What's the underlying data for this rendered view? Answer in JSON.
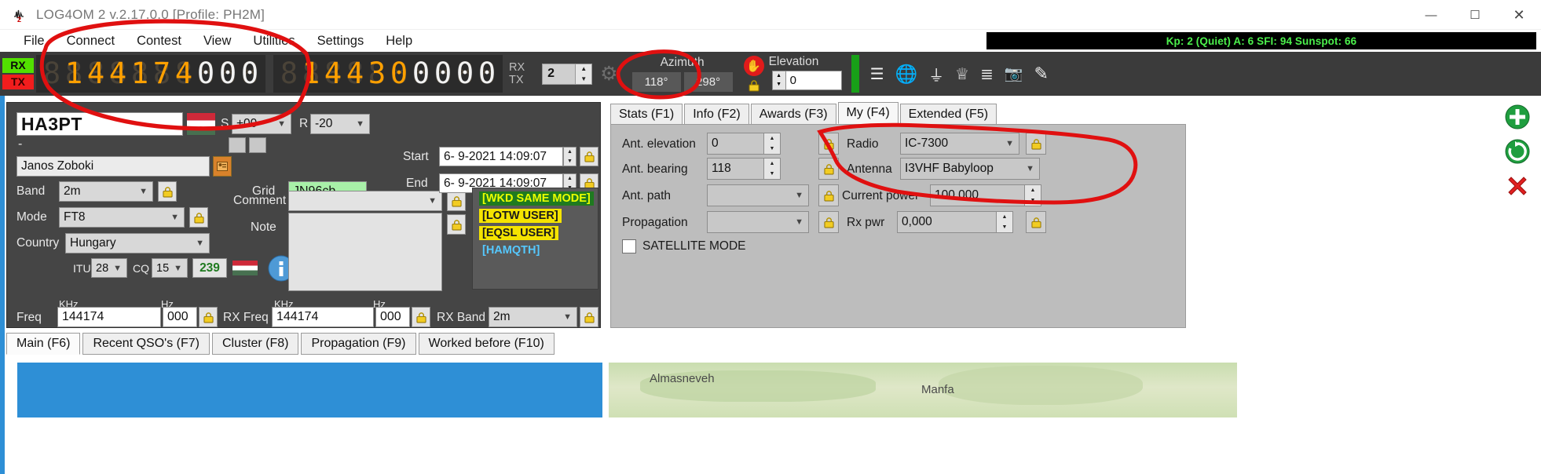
{
  "window": {
    "title": "LOG4OM 2 v.2.17.0.0 [Profile: PH2M]",
    "icon": "log4om-icon",
    "minimize": "—",
    "maximize": "☐",
    "close": "✕"
  },
  "menubar": {
    "items": [
      {
        "label": "File",
        "name": "menu-file"
      },
      {
        "label": "Connect",
        "name": "menu-connect"
      },
      {
        "label": "Contest",
        "name": "menu-contest"
      },
      {
        "label": "View",
        "name": "menu-view"
      },
      {
        "label": "Utilities",
        "name": "menu-utilities"
      },
      {
        "label": "Settings",
        "name": "menu-settings"
      },
      {
        "label": "Help",
        "name": "menu-help"
      }
    ],
    "space_weather": "Kp: 2 (Quiet)  A: 6  SFI: 94 Sunspot: 66"
  },
  "toolbar": {
    "rx_label": "RX",
    "tx_label": "TX",
    "tx_frequency_digits": "0144174000",
    "rx_frequency_digits": "0144300000",
    "tx_rx_caption_1": "RX",
    "tx_rx_caption_2": "TX",
    "radio_selector_value": "2",
    "gear_icon": "gear-icon",
    "azimuth_label": "Azimuth",
    "azimuth_value_1": "118°",
    "azimuth_value_2": "298°",
    "rotor_stop_icon": "hand-stop-icon",
    "elevation_label": "Elevation",
    "elevation_value": "0",
    "elevation_lock_icon": "lock-icon",
    "icons": [
      {
        "name": "signal-icon",
        "glyph": "📶"
      },
      {
        "name": "globe-icon",
        "glyph": "🌐"
      },
      {
        "name": "antenna-icon",
        "glyph": "⮟"
      },
      {
        "name": "award-icon",
        "glyph": "🏅"
      },
      {
        "name": "list-icon",
        "glyph": "☰"
      },
      {
        "name": "camera-icon",
        "glyph": "📷"
      },
      {
        "name": "pencil-icon",
        "glyph": "✎"
      }
    ]
  },
  "qso": {
    "callsign": "HA3PT",
    "flag": "hungary-flag",
    "s_label": "S",
    "s_value": "+00",
    "r_label": "R",
    "r_value": "-20",
    "dash": "-",
    "operator_name": "Janos Zoboki",
    "contact_icon": "contact-card-icon",
    "band_label": "Band",
    "band_value": "2m",
    "mode_label": "Mode",
    "mode_value": "FT8",
    "country_label": "Country",
    "country_value": "Hungary",
    "itu_label": "ITU",
    "itu_value": "28",
    "cq_label": "CQ",
    "cq_value": "15",
    "dxcc_value": "239",
    "info_icon": "info-icon",
    "grid_label": "Grid",
    "grid_value": "JN96cb",
    "comment_label": "Comment",
    "comment_value": "",
    "note_label": "Note",
    "note_value": "",
    "start_label": "Start",
    "start_value": "6- 9-2021 14:09:07",
    "end_label": "End",
    "end_value": "6- 9-2021 14:09:07",
    "badges": [
      {
        "text": "[WKD SAME MODE]",
        "style": "wkd"
      },
      {
        "text": "[LOTW USER]",
        "style": "lotw"
      },
      {
        "text": "[EQSL USER]",
        "style": "eqsl"
      },
      {
        "text": "[HAMQTH]",
        "style": "hamqth"
      }
    ],
    "freq_label": "Freq",
    "freq_khz_caption": "KHz",
    "freq_hz_caption": "Hz",
    "freq_khz": "144174",
    "freq_hz": "000",
    "rx_freq_label": "RX Freq",
    "rx_freq_khz_caption": "KHz",
    "rx_freq_hz_caption": "Hz",
    "rx_freq_khz": "144174",
    "rx_freq_hz": "000",
    "rx_band_label": "RX Band",
    "rx_band_value": "2m",
    "lock_icon": "lock-icon"
  },
  "right_panel": {
    "tabs": [
      {
        "label": "Stats (F1)",
        "name": "tab-stats",
        "active": false
      },
      {
        "label": "Info (F2)",
        "name": "tab-info",
        "active": false
      },
      {
        "label": "Awards (F3)",
        "name": "tab-awards",
        "active": false
      },
      {
        "label": "My (F4)",
        "name": "tab-my",
        "active": true
      },
      {
        "label": "Extended (F5)",
        "name": "tab-extended",
        "active": false
      }
    ],
    "ant_elevation_label": "Ant. elevation",
    "ant_elevation_value": "0",
    "ant_bearing_label": "Ant. bearing",
    "ant_bearing_value": "118",
    "ant_path_label": "Ant. path",
    "ant_path_value": "",
    "propagation_label": "Propagation",
    "propagation_value": "",
    "satellite_mode_label": "SATELLITE MODE",
    "satellite_mode_checked": false,
    "radio_label": "Radio",
    "radio_value": "IC-7300",
    "antenna_label": "Antenna",
    "antenna_value": "I3VHF Babyloop",
    "current_power_label": "Current power",
    "current_power_value": "100,000",
    "rx_pwr_label": "Rx pwr",
    "rx_pwr_value": "0,000",
    "lock_icon": "lock-icon"
  },
  "bottom_tabs": [
    {
      "label": "Main (F6)",
      "name": "tab-main",
      "active": true
    },
    {
      "label": "Recent QSO's (F7)",
      "name": "tab-recent-qsos",
      "active": false
    },
    {
      "label": "Cluster (F8)",
      "name": "tab-cluster",
      "active": false
    },
    {
      "label": "Propagation (F9)",
      "name": "tab-propagation",
      "active": false
    },
    {
      "label": "Worked before (F10)",
      "name": "tab-worked-before",
      "active": false
    }
  ],
  "map": {
    "place_1": "Almasneveh",
    "place_2": "Manfa"
  },
  "side_icons": [
    {
      "name": "add-qso-icon",
      "glyph": "➕",
      "color": "#1f9e3f"
    },
    {
      "name": "refresh-qso-icon",
      "glyph": "⟳",
      "color": "#1f9e3f"
    },
    {
      "name": "delete-qso-icon",
      "glyph": "✖",
      "color": "#e02020"
    }
  ],
  "colors": {
    "accent_blue": "#2e8fd6",
    "rx_green": "#52e000",
    "tx_red": "#f11d1d",
    "digit_amber": "#ffa000",
    "annotation_red": "#e01010"
  }
}
